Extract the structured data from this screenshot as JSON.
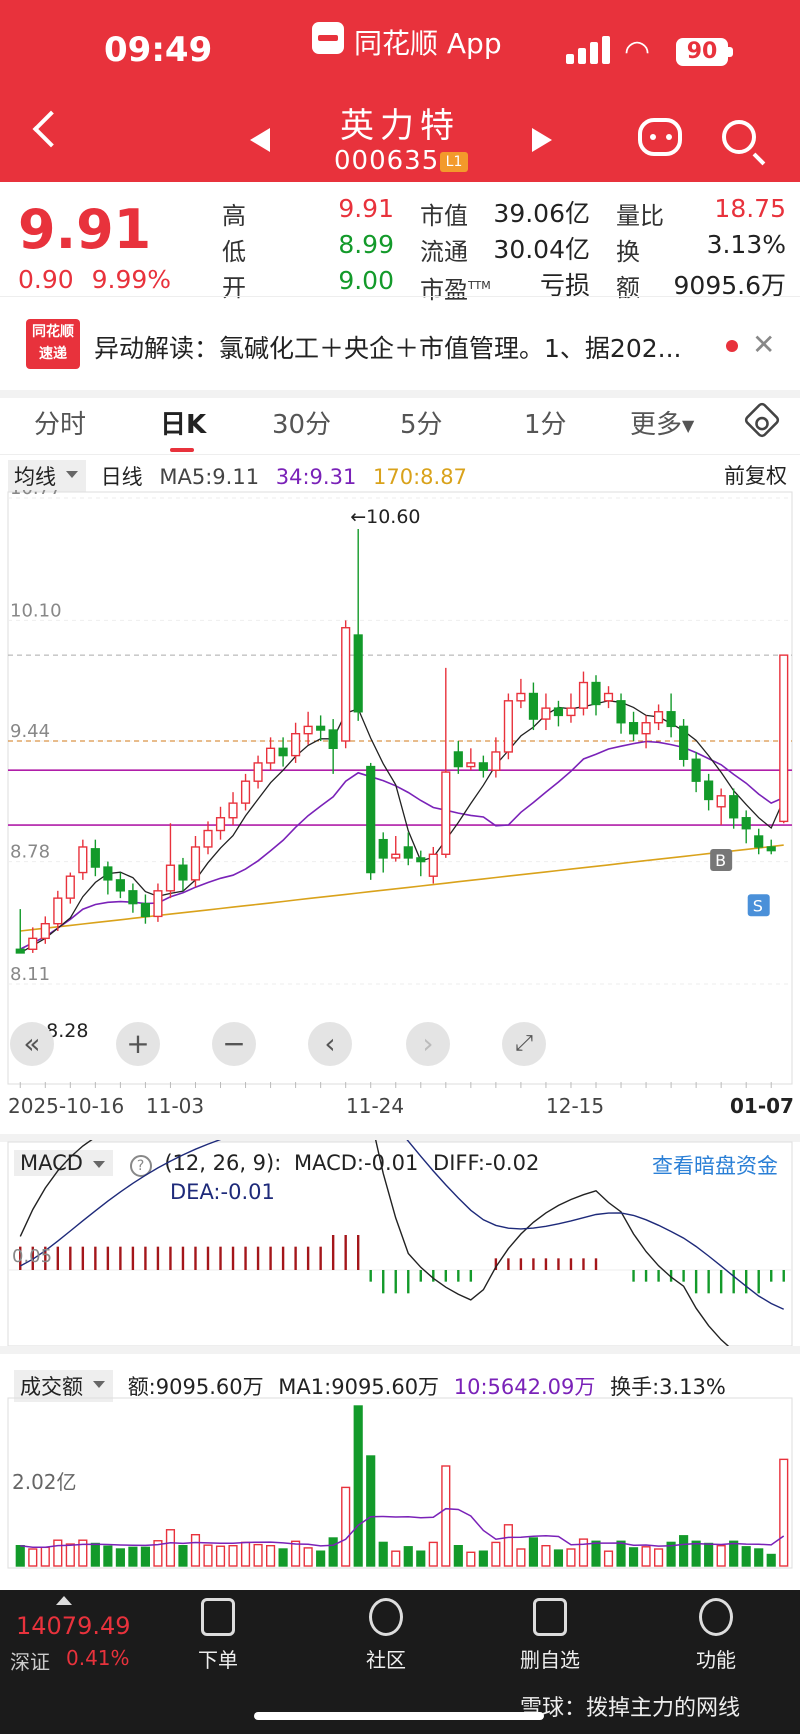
{
  "status": {
    "time": "09:49",
    "app_name": "同花顺 App",
    "battery": "90"
  },
  "stock": {
    "name": "英力特",
    "code": "000635",
    "level": "L1"
  },
  "quote": {
    "price": "9.91",
    "change": "0.90",
    "change_pct": "9.99%",
    "high_label": "高",
    "high": "9.91",
    "low_label": "低",
    "low": "8.99",
    "open_label": "开",
    "open": "9.00",
    "mktcap_label": "市值",
    "mktcap": "39.06亿",
    "float_label": "流通",
    "float": "30.04亿",
    "pe_label": "市盈",
    "pe_sup": "TTM",
    "pe": "亏损",
    "vr_label": "量比",
    "vr": "18.75",
    "turnover_label": "换",
    "turnover": "3.13%",
    "amount_label": "额",
    "amount": "9095.6万"
  },
  "alert": {
    "logo_line1": "同花顺",
    "logo_line2": "速递",
    "text": "异动解读：氯碱化工＋央企＋市值管理。1、据202..."
  },
  "tabs": [
    "分时",
    "日K",
    "30分",
    "5分",
    "1分",
    "更多"
  ],
  "active_tab": "日K",
  "kline": {
    "indicator": "均线",
    "period": "日线",
    "ma5": "MA5:9.11",
    "ma34": "34:9.31",
    "ma170": "170:8.87",
    "adjust": "前复权",
    "y_labels": [
      "10.77",
      "10.10",
      "9.44",
      "8.78",
      "8.11"
    ],
    "high_mark": "←10.60",
    "low_mark": "←8.28",
    "x_labels": [
      "2025-10-16",
      "11-03",
      "11-24",
      "12-15",
      "01-07"
    ],
    "buy_tag": "B",
    "sell_tag": "S"
  },
  "macd": {
    "name": "MACD",
    "params": "(12, 26, 9):",
    "macd": "MACD:-0.01",
    "diff": "DIFF:-0.02",
    "dea": "DEA:-0.01",
    "link": "查看暗盘资金",
    "y_label": "0.05"
  },
  "volume": {
    "name": "成交额",
    "amount": "额:9095.60万",
    "ma1": "MA1:9095.60万",
    "ma10": "10:5642.09万",
    "turnover": "换手:3.13%",
    "y_label": "2.02亿"
  },
  "bottom": {
    "index_value": "14079.49",
    "index_name": "深证",
    "index_change": "0.41%",
    "nav": [
      "下单",
      "社区",
      "删自选",
      "功能"
    ],
    "watermark": "雪球：拨掉主力的网线"
  },
  "colors": {
    "brand": "#e8323c",
    "up": "#e8323c",
    "down": "#139a2a",
    "ma34": "#7a22b8",
    "ma170": "#d9a21b"
  },
  "chart_data": {
    "type": "candlestick",
    "x_range": [
      "2025-10-16",
      "01-07"
    ],
    "price_ylim": [
      8.11,
      10.77
    ],
    "candles": [
      [
        8.3,
        8.28,
        8.52,
        8.28
      ],
      [
        8.3,
        8.36,
        8.42,
        8.28
      ],
      [
        8.36,
        8.44,
        8.48,
        8.33
      ],
      [
        8.44,
        8.58,
        8.62,
        8.4
      ],
      [
        8.58,
        8.7,
        8.72,
        8.55
      ],
      [
        8.72,
        8.86,
        8.9,
        8.68
      ],
      [
        8.85,
        8.75,
        8.9,
        8.7
      ],
      [
        8.75,
        8.68,
        8.78,
        8.6
      ],
      [
        8.68,
        8.62,
        8.72,
        8.58
      ],
      [
        8.62,
        8.55,
        8.66,
        8.5
      ],
      [
        8.55,
        8.48,
        8.6,
        8.44
      ],
      [
        8.48,
        8.62,
        8.66,
        8.45
      ],
      [
        8.62,
        8.76,
        8.99,
        8.58
      ],
      [
        8.76,
        8.68,
        8.8,
        8.62
      ],
      [
        8.68,
        8.86,
        8.92,
        8.64
      ],
      [
        8.86,
        8.95,
        9.0,
        8.82
      ],
      [
        8.95,
        9.02,
        9.08,
        8.9
      ],
      [
        9.02,
        9.1,
        9.16,
        8.98
      ],
      [
        9.1,
        9.22,
        9.26,
        9.06
      ],
      [
        9.22,
        9.32,
        9.36,
        9.18
      ],
      [
        9.32,
        9.4,
        9.46,
        9.28
      ],
      [
        9.4,
        9.36,
        9.46,
        9.3
      ],
      [
        9.36,
        9.48,
        9.54,
        9.32
      ],
      [
        9.48,
        9.52,
        9.6,
        9.42
      ],
      [
        9.52,
        9.5,
        9.58,
        9.44
      ],
      [
        9.5,
        9.4,
        9.56,
        9.26
      ],
      [
        9.44,
        10.06,
        10.1,
        9.4
      ],
      [
        10.02,
        9.6,
        10.6,
        9.55
      ],
      [
        9.3,
        8.72,
        9.32,
        8.68
      ],
      [
        8.9,
        8.8,
        8.94,
        8.72
      ],
      [
        8.8,
        8.82,
        8.92,
        8.78
      ],
      [
        8.86,
        8.8,
        8.94,
        8.76
      ],
      [
        8.8,
        8.78,
        8.84,
        8.7
      ],
      [
        8.7,
        8.82,
        8.86,
        8.66
      ],
      [
        8.82,
        9.27,
        9.84,
        8.8
      ],
      [
        9.38,
        9.3,
        9.44,
        9.26
      ],
      [
        9.3,
        9.32,
        9.4,
        9.28
      ],
      [
        9.32,
        9.28,
        9.36,
        9.24
      ],
      [
        9.28,
        9.38,
        9.46,
        9.24
      ],
      [
        9.38,
        9.66,
        9.7,
        9.34
      ],
      [
        9.66,
        9.7,
        9.78,
        9.62
      ],
      [
        9.7,
        9.56,
        9.76,
        9.5
      ],
      [
        9.56,
        9.62,
        9.7,
        9.5
      ],
      [
        9.62,
        9.58,
        9.66,
        9.52
      ],
      [
        9.58,
        9.62,
        9.7,
        9.54
      ],
      [
        9.62,
        9.76,
        9.82,
        9.58
      ],
      [
        9.76,
        9.64,
        9.8,
        9.58
      ],
      [
        9.66,
        9.7,
        9.74,
        9.62
      ],
      [
        9.66,
        9.54,
        9.7,
        9.48
      ],
      [
        9.54,
        9.48,
        9.6,
        9.44
      ],
      [
        9.48,
        9.54,
        9.58,
        9.4
      ],
      [
        9.54,
        9.6,
        9.64,
        9.5
      ],
      [
        9.6,
        9.52,
        9.7,
        9.46
      ],
      [
        9.52,
        9.34,
        9.56,
        9.3
      ],
      [
        9.34,
        9.22,
        9.38,
        9.16
      ],
      [
        9.22,
        9.12,
        9.26,
        9.06
      ],
      [
        9.08,
        9.14,
        9.18,
        8.98
      ],
      [
        9.14,
        9.02,
        9.18,
        8.96
      ],
      [
        9.02,
        8.96,
        9.06,
        8.88
      ],
      [
        8.92,
        8.86,
        8.96,
        8.82
      ],
      [
        8.86,
        8.84,
        8.9,
        8.82
      ],
      [
        9.0,
        9.91,
        9.91,
        8.99
      ]
    ],
    "ma5_last": 9.11,
    "ma34_last": 9.31,
    "ma170_last": 8.87,
    "price_levels": [
      9.44,
      9.28,
      8.98,
      9.91
    ],
    "macd_ylim": [
      -0.06,
      0.06
    ],
    "macd_hist": [
      0.02,
      0.02,
      0.02,
      0.02,
      0.02,
      0.02,
      0.02,
      0.02,
      0.02,
      0.02,
      0.02,
      0.02,
      0.02,
      0.02,
      0.02,
      0.02,
      0.02,
      0.02,
      0.02,
      0.02,
      0.02,
      0.02,
      0.02,
      0.02,
      0.02,
      0.03,
      0.03,
      0.03,
      -0.01,
      -0.02,
      -0.02,
      -0.02,
      -0.01,
      -0.01,
      -0.01,
      -0.01,
      -0.01,
      0,
      0.01,
      0.01,
      0.01,
      0.01,
      0.01,
      0.01,
      0.01,
      0.01,
      0.01,
      0,
      0,
      -0.01,
      -0.01,
      -0.01,
      -0.01,
      -0.01,
      -0.02,
      -0.02,
      -0.02,
      -0.02,
      -0.02,
      -0.02,
      -0.01,
      -0.01
    ],
    "volume_ylim_label": "2.02亿"
  }
}
